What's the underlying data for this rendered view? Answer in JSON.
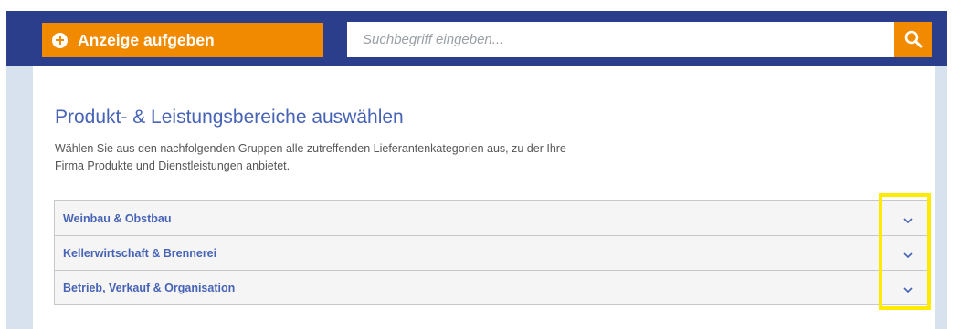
{
  "header": {
    "cta_label": "Anzeige aufgeben",
    "search": {
      "placeholder": "Suchbegriff eingeben...",
      "value": ""
    }
  },
  "icons": {
    "cta": "plus-circle-icon",
    "search": "search-icon",
    "accordion_toggle": "chevron-down-icon"
  },
  "main": {
    "title": "Produkt- & Leistungsbereiche auswählen",
    "intro_line1": "Wählen Sie aus den nachfolgenden Gruppen alle zutreffenden Lieferantenkategorien aus, zu der Ihre",
    "intro_line2": "Firma Produkte und Dienstleistungen anbietet.",
    "groups": [
      {
        "label": "Weinbau & Obstbau",
        "expanded": false
      },
      {
        "label": "Kellerwirtschaft & Brennerei",
        "expanded": false
      },
      {
        "label": "Betrieb, Verkauf & Organisation",
        "expanded": false
      }
    ]
  },
  "colors": {
    "header_bg": "#2b3e8c",
    "accent": "#f28a00",
    "link_blue": "#4663b6",
    "page_bg": "#d7e2ee",
    "highlight": "#ffea00"
  }
}
